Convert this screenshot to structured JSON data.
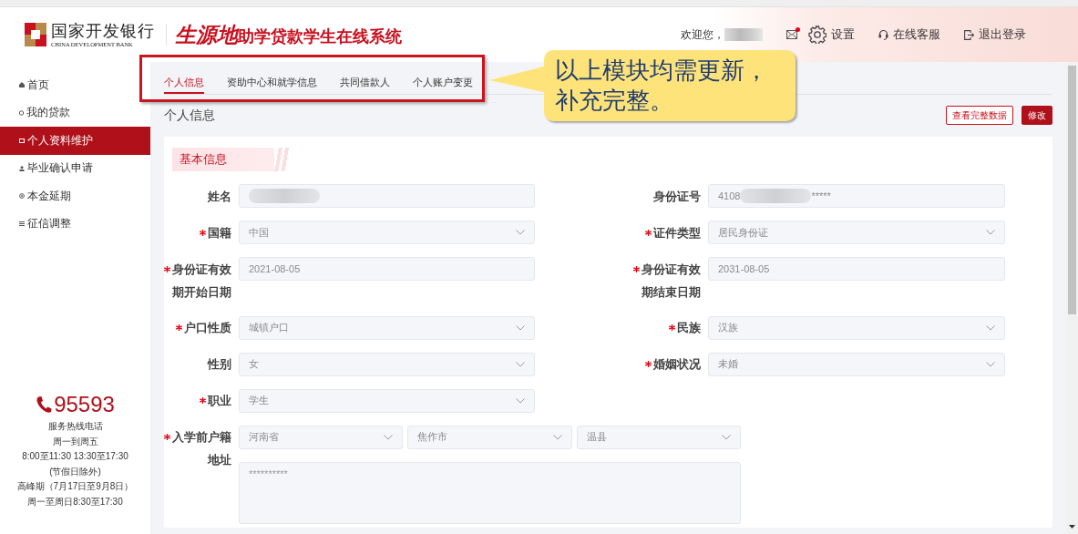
{
  "header": {
    "bank_name": "国家开发银行",
    "bank_name_en": "CHINA DEVELOPMENT BANK",
    "system_title_emphasis": "生源地",
    "system_title_rest": "助学贷款学生在线系统",
    "welcome": "欢迎您，",
    "user_redacted": true,
    "mail_unread": true,
    "links": [
      {
        "kind": "settings",
        "label": "设置"
      },
      {
        "kind": "support",
        "label": "在线客服"
      },
      {
        "kind": "logout",
        "label": "退出登录"
      }
    ]
  },
  "sidebar": {
    "items": [
      {
        "label": "首页",
        "selected": false
      },
      {
        "label": "我的贷款",
        "selected": false
      },
      {
        "label": "个人资料维护",
        "selected": true
      },
      {
        "label": "毕业确认申请",
        "selected": false
      },
      {
        "label": "本金延期",
        "selected": false
      },
      {
        "label": "征信调整",
        "selected": false
      }
    ],
    "hotline": {
      "number": "95593",
      "lines": [
        "服务热线电话",
        "周一到周五",
        "8:00至11:30 13:30至17:30",
        "(节假日除外)",
        "高峰期（7月17日至9月8日）",
        "周一至周日8:30至17:30"
      ]
    }
  },
  "tabs": [
    {
      "label": "个人信息",
      "selected": true
    },
    {
      "label": "资助中心和就学信息",
      "selected": false
    },
    {
      "label": "共同借款人",
      "selected": false
    },
    {
      "label": "个人账户变更",
      "selected": false
    }
  ],
  "page_title": "个人信息",
  "buttons": [
    {
      "label": "查看完整数据",
      "kind": "outline"
    },
    {
      "label": "修改",
      "kind": "primary"
    }
  ],
  "section": {
    "title": "基本信息"
  },
  "fields": [
    {
      "label": "姓名",
      "kind": "text",
      "required": false,
      "redacted": true
    },
    {
      "label": "身份证号",
      "kind": "text",
      "required": false,
      "value": "4108",
      "redacted": true,
      "suffix": "*****"
    },
    {
      "label": "国籍",
      "kind": "select",
      "required": true,
      "value": "中国"
    },
    {
      "label": "证件类型",
      "kind": "select",
      "required": true,
      "value": "居民身份证"
    },
    {
      "label": "身份证有效期开始日期",
      "kind": "text",
      "required": true,
      "value": "2021-08-05"
    },
    {
      "label": "身份证有效期结束日期",
      "kind": "text",
      "required": true,
      "value": "2031-08-05"
    },
    {
      "label": "户口性质",
      "kind": "select",
      "required": true,
      "value": "城镇户口"
    },
    {
      "label": "民族",
      "kind": "select",
      "required": true,
      "value": "汉族"
    },
    {
      "label": "性别",
      "kind": "select",
      "required": false,
      "value": "女"
    },
    {
      "label": "婚姻状况",
      "kind": "select",
      "required": true,
      "value": "未婚"
    },
    {
      "label": "职业",
      "kind": "select",
      "required": true,
      "value": "学生"
    },
    {
      "label": "入学前户籍地址",
      "kind": "address",
      "required": true,
      "parts": [
        "河南省",
        "焦作市",
        "温县"
      ],
      "placeholder": "**********"
    }
  ],
  "annotation": {
    "lines": [
      "以上模块均需更新，",
      "补充完整。"
    ]
  }
}
